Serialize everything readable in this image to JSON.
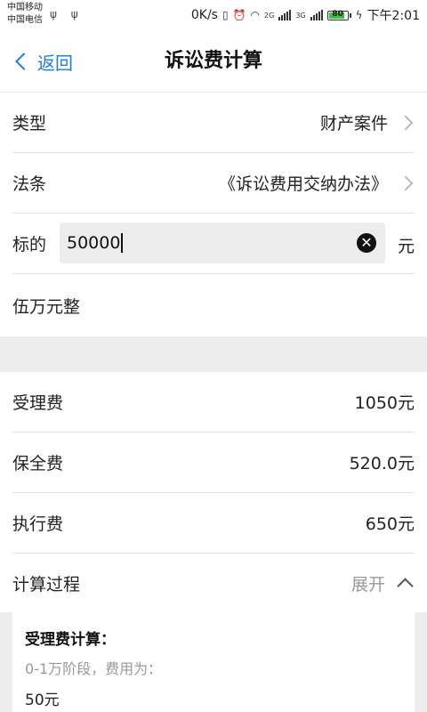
{
  "status_bar": {
    "carrier1": "中国移动",
    "carrier2": "中国电信",
    "usb_icons": "ψ ψ",
    "net_speed": "0K/s",
    "network1": "2G",
    "network2": "3G",
    "battery_level": "80",
    "time": "下午2:01"
  },
  "nav": {
    "back_label": "返回",
    "title": "诉讼费计算"
  },
  "form": {
    "type_label": "类型",
    "type_value": "财产案件",
    "law_label": "法条",
    "law_value": "《诉讼费用交纳办法》",
    "amount_label": "标的",
    "amount_value": "50000",
    "clear_glyph": "✕",
    "amount_unit": "元",
    "amount_in_words": "伍万元整"
  },
  "results": [
    {
      "label": "受理费",
      "value": "1050元"
    },
    {
      "label": "保全费",
      "value": "520.0元"
    },
    {
      "label": "执行费",
      "value": "650元"
    }
  ],
  "process": {
    "label": "计算过程",
    "toggle_label": "展开"
  },
  "detail": {
    "title": "受理费计算：",
    "description": "0-1万阶段，费用为：",
    "result": "50元"
  }
}
